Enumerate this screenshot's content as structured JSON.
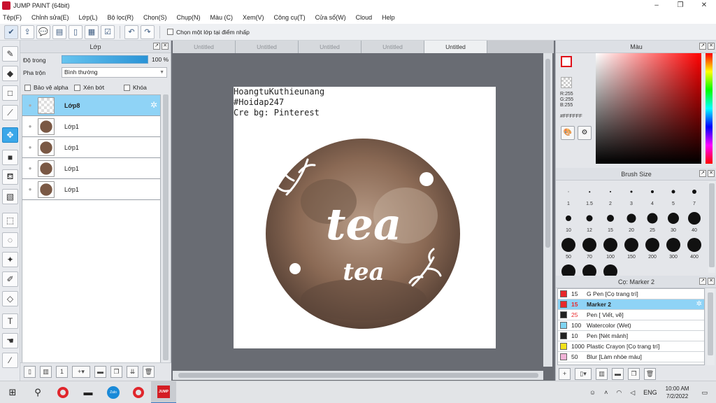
{
  "window": {
    "title": "JUMP PAINT (64bit)",
    "controls": [
      "–",
      "❐",
      "✕"
    ]
  },
  "menu": [
    "Tệp(F)",
    "Chỉnh sửa(E)",
    "Lớp(L)",
    "Bộ lọc(R)",
    "Chọn(S)",
    "Chụp(N)",
    "Màu (C)",
    "Xem(V)",
    "Công cụ(T)",
    "Cửa sổ(W)",
    "Cloud",
    "Help"
  ],
  "toolbar": {
    "checkbox_label": "Chọn một lớp tại điểm nhấp"
  },
  "layer_panel": {
    "title": "Lớp",
    "opacity_label": "Độ trong",
    "opacity_value": "100 %",
    "opacity_fraction": 1.0,
    "blend_label": "Pha trộn",
    "blend_value": "Bình thường",
    "options": [
      "Bảo vệ alpha",
      "Xén bớt",
      "Khóa"
    ],
    "layers": [
      {
        "name": "Lớp8",
        "thumb": "transparent",
        "selected": true
      },
      {
        "name": "Lớp1",
        "thumb": "image",
        "selected": false
      },
      {
        "name": "Lớp1",
        "thumb": "image",
        "selected": false
      },
      {
        "name": "Lớp1",
        "thumb": "image",
        "selected": false
      },
      {
        "name": "Lớp1",
        "thumb": "image",
        "selected": false
      }
    ]
  },
  "doc_tabs": [
    {
      "label": "Untitled",
      "active": false
    },
    {
      "label": "Untitled",
      "active": false
    },
    {
      "label": "Untitled",
      "active": false
    },
    {
      "label": "Untitled",
      "active": false
    },
    {
      "label": "Untitled",
      "active": true
    }
  ],
  "canvas": {
    "caption_lines": [
      "HoangtuKuthieunang",
      "#Hoidap247",
      "Cre bg: Pinterest"
    ],
    "artwork_text_large": "tea",
    "artwork_text_small": "tea"
  },
  "color_panel": {
    "title": "Màu",
    "r": "R:255",
    "g": "G:255",
    "b": "B:255",
    "hex": "#FFFFFF",
    "fg_color": "#ffffff",
    "accent": "#e0101a"
  },
  "brush_panel": {
    "title": "Brush Size",
    "sizes": [
      "1",
      "1.5",
      "2",
      "3",
      "4",
      "5",
      "7",
      "10",
      "12",
      "15",
      "20",
      "25",
      "30",
      "40",
      "50",
      "70",
      "100",
      "150",
      "200",
      "300",
      "400",
      "",
      "",
      ""
    ]
  },
  "tool_panel": {
    "title": "Cọ: Marker 2",
    "items": [
      {
        "size": "15",
        "name": "G Pen [Cọ trang trí]",
        "color": "#e8282b",
        "selected": false
      },
      {
        "size": "15",
        "name": "Marker 2",
        "color": "#e8282b",
        "selected": true
      },
      {
        "size": "25",
        "name": "Pen [ Viết, vẽ]",
        "color": "#222222",
        "selected": false
      },
      {
        "size": "100",
        "name": "Watercolor (Wet)",
        "color": "#7fd4f2",
        "selected": false
      },
      {
        "size": "10",
        "name": "Pen [Nét mảnh]",
        "color": "#222222",
        "selected": false
      },
      {
        "size": "1000",
        "name": "Plastic Crayon [Cọ trang trí]",
        "color": "#f2e21b",
        "selected": false
      },
      {
        "size": "50",
        "name": "Blur [Làm nhòe màu]",
        "color": "#f1b3d7",
        "selected": false
      }
    ]
  },
  "taskbar": {
    "lang": "ENG",
    "time": "10:00 AM",
    "date": "7/2/2022"
  }
}
